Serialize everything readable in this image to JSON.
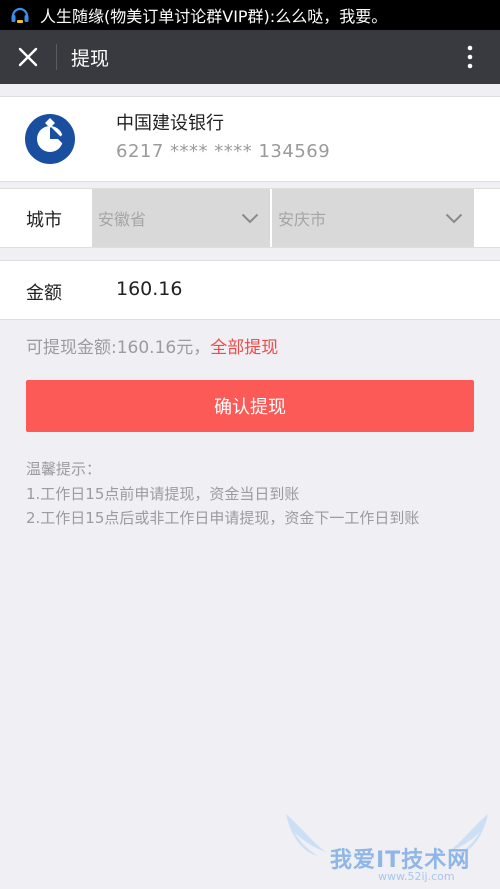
{
  "status_bar": {
    "notification": "人生随缘(物美订单讨论群VIP群):么么哒，我要。"
  },
  "title_bar": {
    "title": "提现"
  },
  "bank_card": {
    "bank_name": "中国建设银行",
    "card_number": "6217 **** **** 134569"
  },
  "city_row": {
    "label": "城市",
    "province": "安徽省",
    "city": "安庆市"
  },
  "amount_row": {
    "label": "金额",
    "value": "160.16"
  },
  "available": {
    "text": "可提现金额:160.16元，",
    "withdraw_all": "全部提现"
  },
  "confirm_button": "确认提现",
  "tips": {
    "title": "温馨提示：",
    "lines": [
      "1.工作日15点前申请提现，资金当日到账",
      "2.工作日15点后或非工作日申请提现，资金下一工作日到账"
    ]
  },
  "watermark": {
    "text": "我爱IT技术网",
    "url": "www.52ij.com"
  },
  "colors": {
    "title_bar": "#393a3f",
    "accent": "#fb5a57",
    "link": "#f04b4b",
    "bank_blue": "#1a4fa0"
  }
}
